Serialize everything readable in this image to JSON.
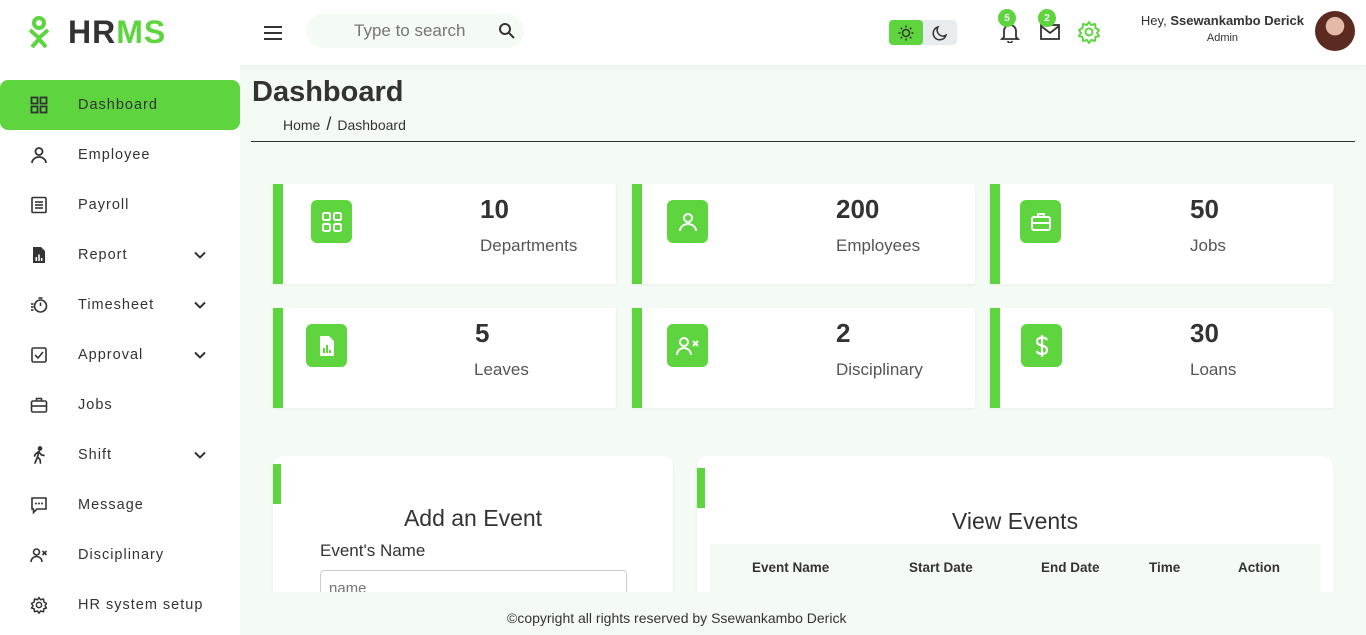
{
  "app": {
    "logo_hr": "HR",
    "logo_ms": "MS"
  },
  "search": {
    "placeholder": "Type to search"
  },
  "notifications": {
    "bell_count": "5",
    "mail_count": "2"
  },
  "user": {
    "greeting": "Hey, ",
    "name": "Ssewankambo Derick",
    "role": "Admin"
  },
  "sidebar": {
    "items": [
      {
        "label": "Dashboard",
        "icon": "dashboard-icon",
        "active": true
      },
      {
        "label": "Employee",
        "icon": "user-icon"
      },
      {
        "label": "Payroll",
        "icon": "list-icon"
      },
      {
        "label": "Report",
        "icon": "report-icon",
        "expandable": true
      },
      {
        "label": "Timesheet",
        "icon": "timer-icon",
        "expandable": true
      },
      {
        "label": "Approval",
        "icon": "checkbox-icon",
        "expandable": true
      },
      {
        "label": "Jobs",
        "icon": "briefcase-icon"
      },
      {
        "label": "Shift",
        "icon": "walking-icon",
        "expandable": true
      },
      {
        "label": "Message",
        "icon": "message-icon"
      },
      {
        "label": "Disciplinary",
        "icon": "user-x-icon"
      },
      {
        "label": "HR system setup",
        "icon": "gear-icon"
      }
    ]
  },
  "page": {
    "title": "Dashboard",
    "breadcrumb_home": "Home",
    "breadcrumb_sep": "/",
    "breadcrumb_current": "Dashboard"
  },
  "stats": [
    {
      "value": "10",
      "label": "Departments",
      "icon": "grid-icon"
    },
    {
      "value": "200",
      "label": "Employees",
      "icon": "user-icon"
    },
    {
      "value": "50",
      "label": "Jobs",
      "icon": "briefcase-icon"
    },
    {
      "value": "5",
      "label": "Leaves",
      "icon": "document-chart-icon"
    },
    {
      "value": "2",
      "label": "Disciplinary",
      "icon": "user-x-icon"
    },
    {
      "value": "30",
      "label": "Loans",
      "icon": "dollar-icon"
    }
  ],
  "add_event": {
    "title": "Add an Event",
    "name_label": "Event's Name",
    "name_placeholder": "name"
  },
  "view_events": {
    "title": "View Events",
    "columns": [
      "Event Name",
      "Start Date",
      "End Date",
      "Time",
      "Action"
    ]
  },
  "footer": {
    "text": "©copyright all rights reserved by Ssewankambo Derick"
  },
  "colors": {
    "accent": "#5ed43f",
    "background": "#f4fbf4",
    "text": "#333333"
  }
}
